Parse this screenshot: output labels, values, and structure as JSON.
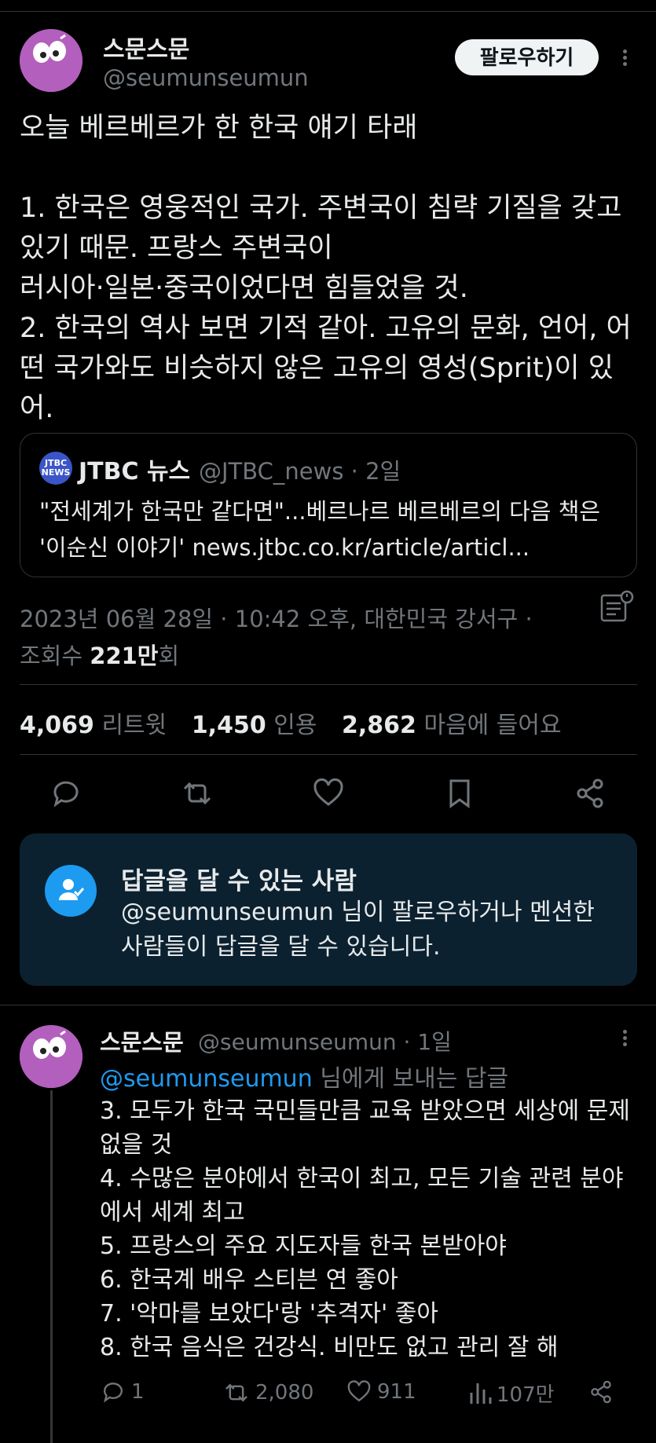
{
  "tweet": {
    "author_name": "스문스문",
    "author_handle": "@seumunseumun",
    "follow_label": "팔로우하기",
    "text": "오늘 베르베르가 한 한국 얘기 타래\n\n1. 한국은 영웅적인 국가. 주변국이 침략 기질을 갖고 있기 때문. 프랑스 주변국이\n러시아·일본·중국이었다면 힘들었을 것.\n2. 한국의 역사 보면 기적 같아. 고유의 문화, 언어, 어떤 국가와도 비슷하지 않은 고유의 영성(Sprit)이 있어.",
    "quote": {
      "logo_text": "JTBC NEWS",
      "name": "JTBC 뉴스",
      "handle_time": "@JTBC_news · 2일",
      "text": "\"전세계가 한국만 같다면\"...베르나르 베르베르의 다음 책은 '이순신 이야기' news.jtbc.co.kr/article/articl..."
    },
    "timestamp": "2023년 06월 28일 · 10:42 오후, 대한민국 강서구 ·",
    "views_label": "조회수",
    "views_value": "221만",
    "views_suffix": "회",
    "stats": {
      "retweets": "4,069",
      "retweets_label": "리트윗",
      "quotes": "1,450",
      "quotes_label": "인용",
      "likes": "2,862",
      "likes_label": "마음에 들어요"
    }
  },
  "reply_restriction": {
    "title": "답글을 달 수 있는 사람",
    "description": "@seumunseumun 님이 팔로우하거나 멘션한 사람들이 답글을 달 수 있습니다."
  },
  "reply": {
    "author_name": "스문스문",
    "author_handle_time": "@seumunseumun · 1일",
    "replying_to_mention": "@seumunseumun",
    "replying_to_suffix": " 님에게 보내는 답글",
    "text": "3. 모두가 한국 국민들만큼 교육 받았으면 세상에 문제 없을 것\n4. 수많은 분야에서 한국이 최고, 모든 기술 관련 분야에서 세계 최고\n5. 프랑스의 주요 지도자들 한국 본받아야\n6. 한국계 배우 스티븐 연 좋아\n7. '악마를 보았다'랑 '추격자' 좋아\n8. 한국 음식은 건강식. 비만도 없고 관리 잘 해",
    "reply_count": "1",
    "retweet_count": "2,080",
    "like_count": "911",
    "view_count": "107만"
  },
  "colors": {
    "background": "#000000",
    "text_primary": "#e7e9ea",
    "text_secondary": "#71767b",
    "accent": "#1d9bf0",
    "avatar": "#b35fbd",
    "reply_box": "#0b2130"
  },
  "icons": [
    "more-icon",
    "analytics-icon",
    "reply-icon",
    "retweet-icon",
    "like-icon",
    "bookmark-icon",
    "share-icon",
    "person-check-icon",
    "views-icon"
  ]
}
